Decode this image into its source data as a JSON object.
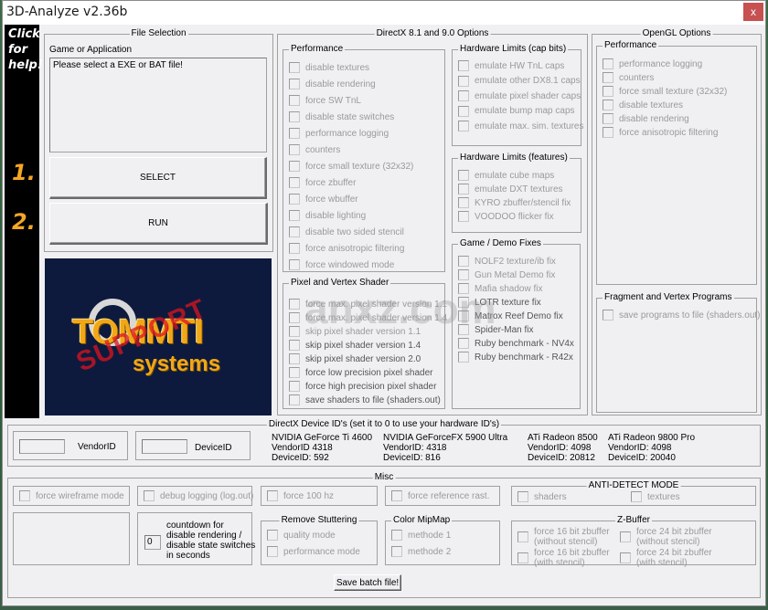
{
  "window": {
    "title": "3D-Analyze v2.36b",
    "close_label": "x"
  },
  "help": {
    "text_lines": [
      "Click",
      "for",
      "help!"
    ],
    "step1": "1.",
    "step2": "2."
  },
  "file_selection": {
    "title": "File Selection",
    "field_label": "Game or Application",
    "field_value": "Please select a EXE or BAT file!",
    "select_label": "SELECT",
    "run_label": "RUN"
  },
  "logo": {
    "main": "TOMMTI",
    "sub": "systems",
    "stamp": "SUPPORT"
  },
  "directx": {
    "title": "DirectX 8.1 and 9.0 Options",
    "performance": {
      "title": "Performance",
      "items": [
        "disable textures",
        "disable rendering",
        "force SW TnL",
        "disable state switches",
        "performance logging",
        "counters",
        "force small texture (32x32)",
        "force zbuffer",
        "force wbuffer",
        "disable lighting",
        "disable two sided stencil",
        "force anisotropic filtering",
        "force windowed mode"
      ]
    },
    "pixel_vertex": {
      "title": "Pixel and Vertex Shader",
      "items": [
        "force max. pixel shader version 1.1",
        "force max. pixel shader version 1.4",
        "skip pixel shader version 1.1",
        "skip pixel shader version 1.4",
        "skip pixel shader version 2.0",
        "force low precision pixel shader",
        "force high precision pixel shader",
        "save shaders to file (shaders.out)"
      ]
    },
    "cap_bits": {
      "title": "Hardware Limits (cap bits)",
      "items": [
        "emulate HW TnL caps",
        "emulate other DX8.1 caps",
        "emulate pixel shader caps",
        "emulate bump map caps",
        "emulate max. sim. textures"
      ]
    },
    "features": {
      "title": "Hardware Limits (features)",
      "items": [
        "emulate cube maps",
        "emulate DXT textures",
        "KYRO zbuffer/stencil fix",
        "VOODOO flicker fix"
      ]
    },
    "game_fixes": {
      "title": "Game / Demo Fixes",
      "items": [
        "NOLF2 texture/ib fix",
        "Gun Metal Demo fix",
        "Mafia shadow fix",
        "LOTR texture fix",
        "Matrox Reef Demo fix",
        "Spider-Man fix",
        "Ruby benchmark - NV4x",
        "Ruby benchmark - R42x"
      ]
    }
  },
  "opengl": {
    "title": "OpenGL Options",
    "performance": {
      "title": "Performance",
      "items": [
        "performance logging",
        "counters",
        "force small texture (32x32)",
        "disable textures",
        "disable rendering",
        "force anisotropic filtering"
      ]
    },
    "programs": {
      "title": "Fragment and Vertex Programs",
      "items": [
        "save programs to file (shaders.out)"
      ]
    }
  },
  "device_ids": {
    "title": "DirectX Device ID's (set it to 0 to use your hardware ID's)",
    "vendor_label": "VendorID",
    "device_label": "DeviceID",
    "vendor_value": "",
    "device_value": "",
    "cards": [
      {
        "name": "NVIDIA GeForce Ti 4600",
        "vendor": "VendorID 4318",
        "device": "DeviceID: 592"
      },
      {
        "name": "NVIDIA GeForceFX 5900 Ultra",
        "vendor": "VendorID: 4318",
        "device": "DeviceID: 816"
      },
      {
        "name": "ATi Radeon 8500",
        "vendor": "VendorID: 4098",
        "device": "DeviceID: 20812"
      },
      {
        "name": "ATi Radeon 9800 Pro",
        "vendor": "VendorID: 4098",
        "device": "DeviceID: 20040"
      }
    ]
  },
  "misc": {
    "title": "Misc",
    "wireframe": "force wireframe mode",
    "debug_logging": "debug logging (log.out)",
    "force100": "force 100 hz",
    "ref_rast": "force reference rast.",
    "countdown_value": "0",
    "countdown_label_lines": [
      "countdown for",
      "disable rendering /",
      "disable state switches",
      "in seconds"
    ],
    "anti_detect": {
      "title": "ANTI-DETECT MODE",
      "shaders": "shaders",
      "textures": "textures"
    },
    "remove_stuttering": {
      "title": "Remove Stuttering",
      "items": [
        "quality mode",
        "performance mode"
      ]
    },
    "color_mipmap": {
      "title": "Color MipMap",
      "items": [
        "methode 1",
        "methode 2"
      ]
    },
    "zbuffer": {
      "title": "Z-Buffer",
      "items": [
        [
          "force 16 bit zbuffer",
          "(without stencil)"
        ],
        [
          "force 24 bit zbuffer",
          "(without stencil)"
        ],
        [
          "force 16 bit zbuffer",
          "(with stencil)"
        ],
        [
          "force 24 bit zbuffer",
          "(with stencil)"
        ]
      ]
    },
    "save_batch": "Save batch file!"
  }
}
